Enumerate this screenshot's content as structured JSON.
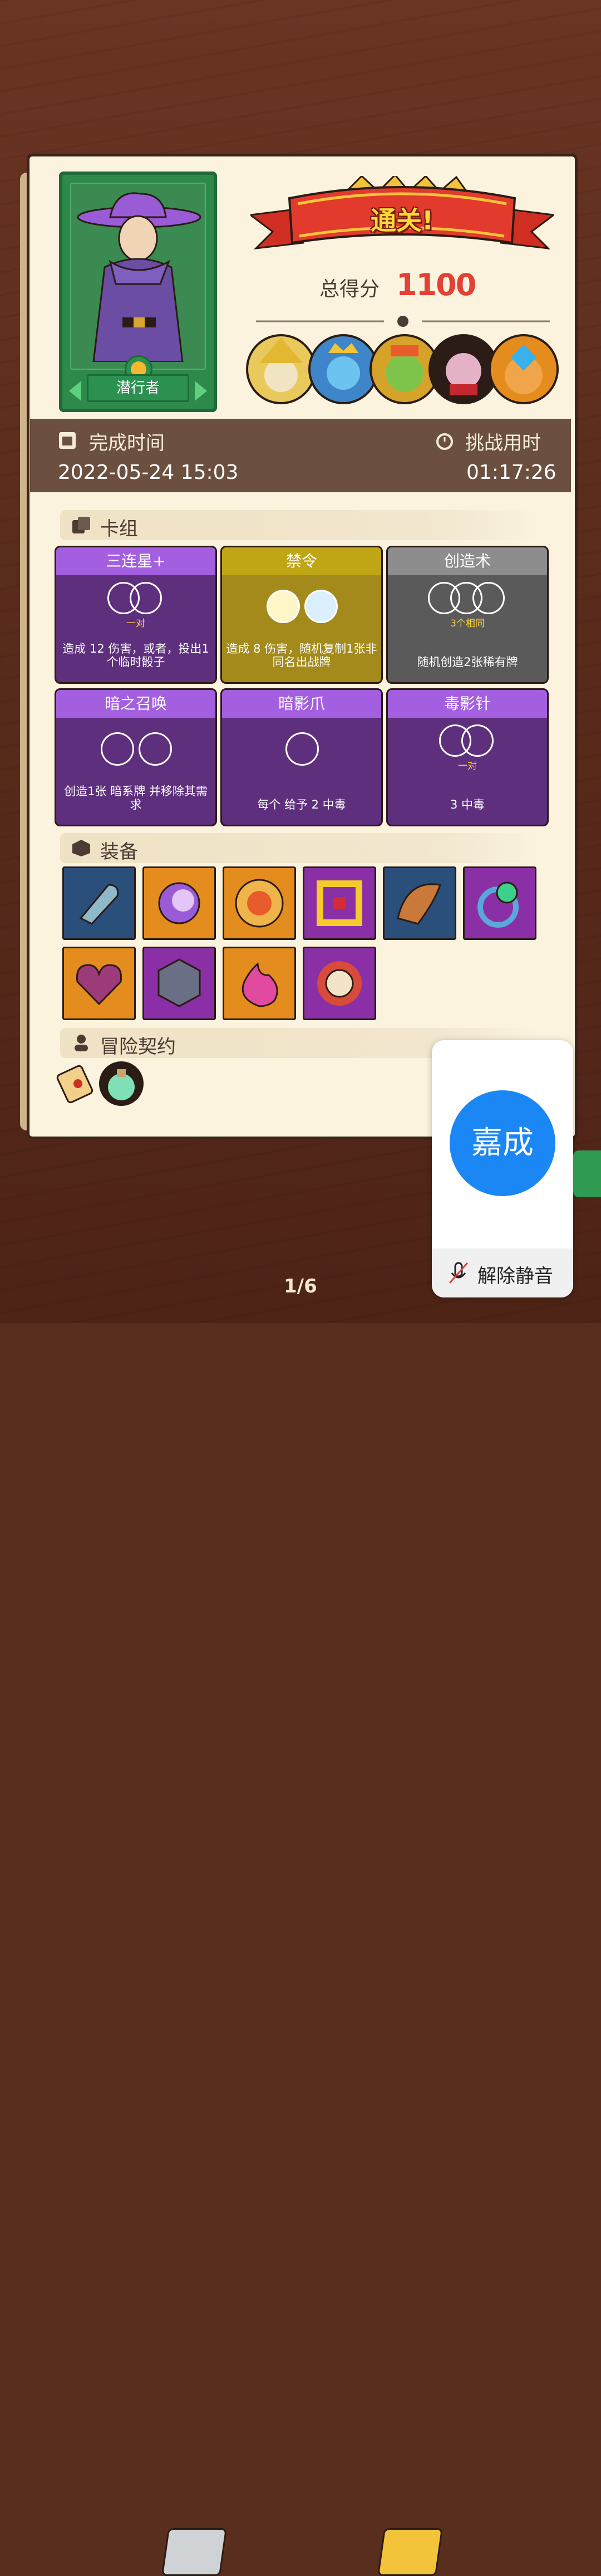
{
  "result": {
    "banner": "通关!",
    "score_label": "总得分",
    "score_value": "1100"
  },
  "hero": {
    "name": "潜行者"
  },
  "time": {
    "complete_label": "完成时间",
    "complete_value": "2022-05-24 15:03",
    "duration_label": "挑战用时",
    "duration_value": "01:17:26"
  },
  "sections": {
    "deck": "卡组",
    "equipment": "装备",
    "contract": "冒险契约"
  },
  "cards": [
    {
      "title": "三连星+",
      "sub": "一对",
      "desc": "造成 12 伤害，或者，投出1个临时骰子",
      "highlight": "或者",
      "color": "purple"
    },
    {
      "title": "禁令",
      "sub": "",
      "desc": "造成 8 伤害，随机复制1张非同名出战牌",
      "color": "olive"
    },
    {
      "title": "创造术",
      "sub": "3个相同",
      "desc": "随机创造2张稀有牌",
      "color": "grey"
    },
    {
      "title": "暗之召唤",
      "sub": "",
      "desc": "创造1张 暗系牌 并移除其需求",
      "color": "purple"
    },
    {
      "title": "暗影爪",
      "sub": "",
      "desc": "每个 给予 2 中毒",
      "color": "purple"
    },
    {
      "title": "毒影针",
      "sub": "一对",
      "desc": "3 中毒",
      "color": "purple"
    }
  ],
  "equipment": [
    {
      "icon": "scythe-icon",
      "color": "blue"
    },
    {
      "icon": "moon-stone-icon",
      "color": "orange"
    },
    {
      "icon": "coin-icon",
      "color": "orange"
    },
    {
      "icon": "gold-frame-icon",
      "color": "purple"
    },
    {
      "icon": "horn-icon",
      "color": "blue"
    },
    {
      "icon": "ring-icon",
      "color": "purple"
    },
    {
      "icon": "broken-heart-icon",
      "color": "orange"
    },
    {
      "icon": "cube-icon",
      "color": "purple"
    },
    {
      "icon": "flame-icon",
      "color": "orange"
    },
    {
      "icon": "sun-skull-icon",
      "color": "purple"
    }
  ],
  "contracts": [
    {
      "icon": "scroll-icon"
    },
    {
      "icon": "potion-icon"
    }
  ],
  "mute_panel": {
    "avatar_text": "嘉成",
    "unmute_label": "解除静音"
  },
  "pager": {
    "text": "1/6"
  },
  "colors": {
    "accent_red": "#e34036",
    "mute_blue": "#1a87f5"
  }
}
